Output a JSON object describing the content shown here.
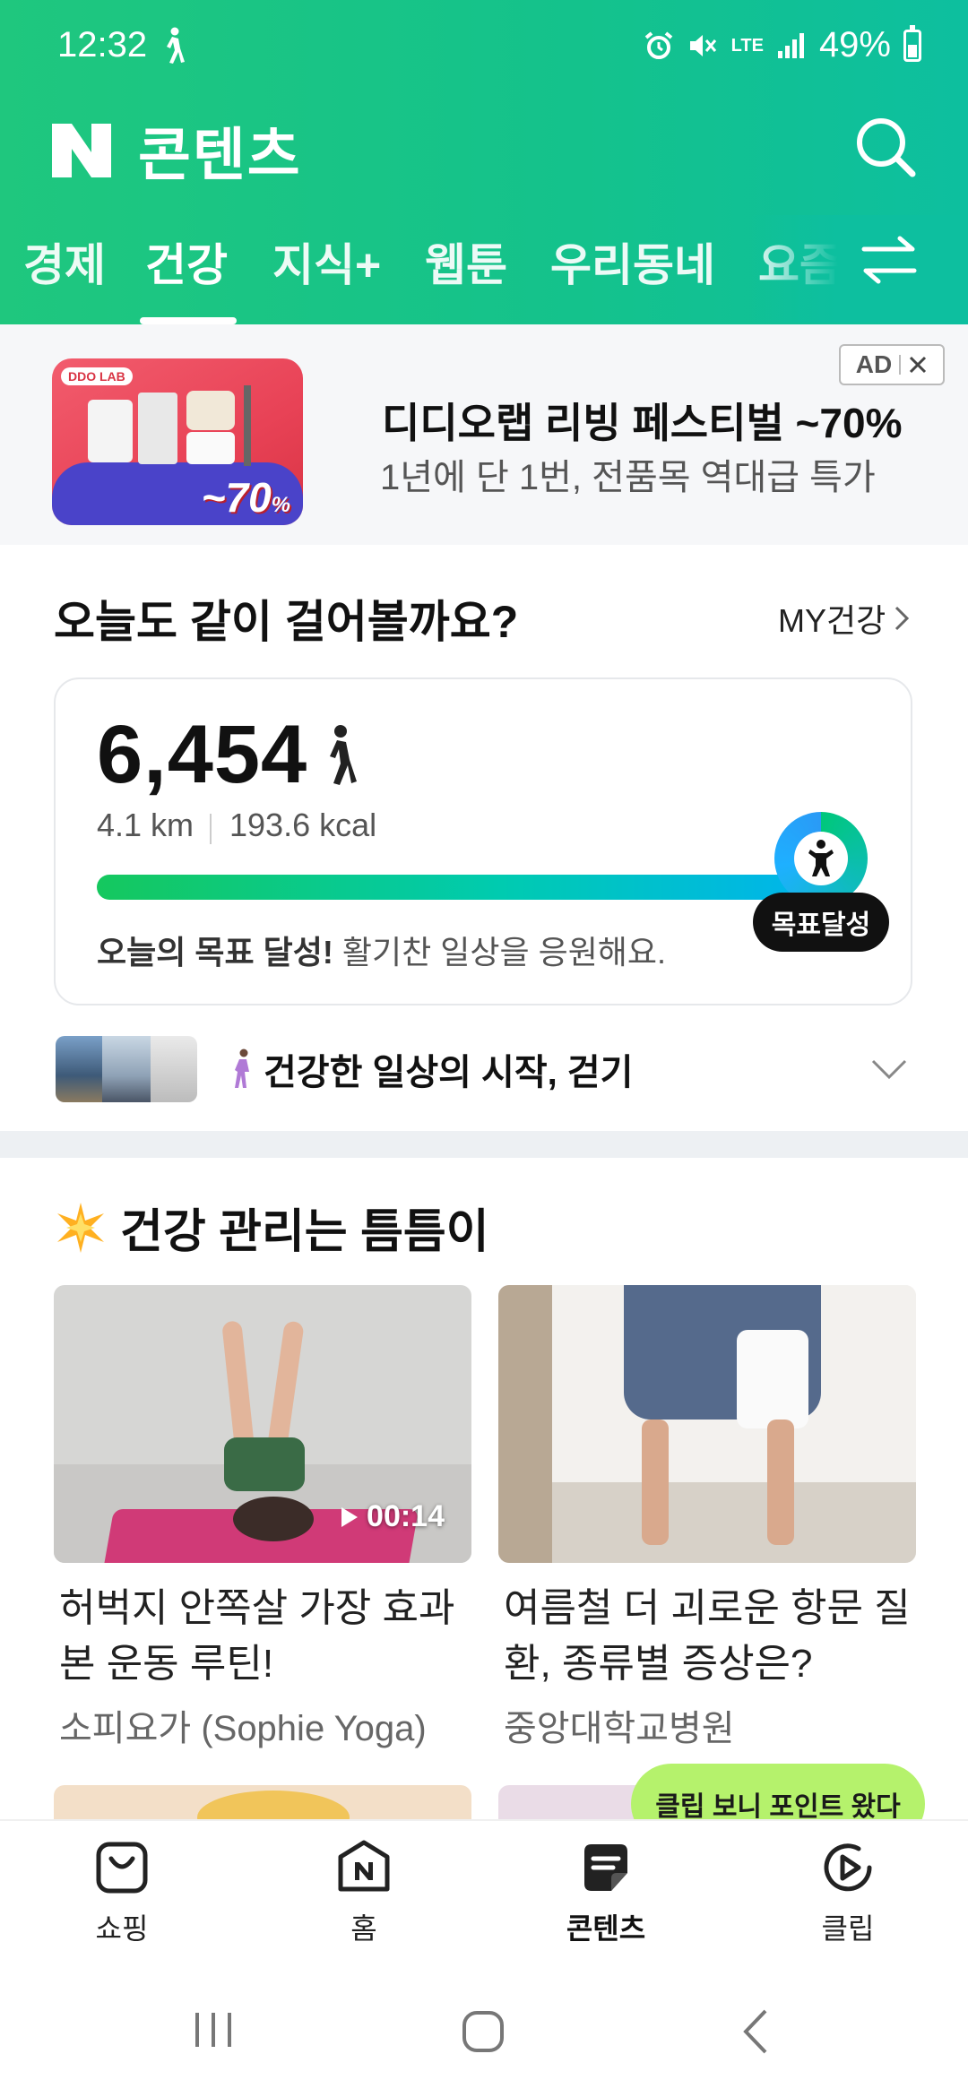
{
  "status": {
    "time": "12:32",
    "network": "LTE",
    "battery": "49%"
  },
  "header": {
    "title": "콘텐츠",
    "tabs": [
      "경제",
      "건강",
      "지식+",
      "웹툰",
      "우리동네",
      "요즘"
    ],
    "active_tab": "건강"
  },
  "ad": {
    "title": "디디오랩 리빙 페스티벌 ~70%",
    "subtitle": "1년에 단 1번, 전품목 역대급 특가",
    "badge": "AD",
    "image_brand": "DDO LAB",
    "image_discount": "~70",
    "image_discount_unit": "%"
  },
  "walk": {
    "heading": "오늘도 같이 걸어볼까요?",
    "my_health_link": "MY건강",
    "steps": "6,454",
    "distance": "4.1 km",
    "calories": "193.6 kcal",
    "progress": 1.0,
    "goal_badge": "목표달성",
    "goal_bold": "오늘의 목표 달성!",
    "goal_rest": " 활기찬 일상을 응원해요.",
    "topic": "건강한 일상의 시작, 걷기"
  },
  "health": {
    "heading": "건강 관리는 틈틈이",
    "cards": [
      {
        "title": "허벅지 안쪽살 가장 효과본 운동 루틴!",
        "source": "소피요가 (Sophie Yoga)",
        "duration": "00:14"
      },
      {
        "title": "여름철 더 괴로운 항문 질환, 종류별 증상은?",
        "source": "중앙대학교병원"
      }
    ]
  },
  "toast": "클립 보니 포인트 왔다",
  "bottom_nav": [
    {
      "label": "쇼핑",
      "icon": "shopping-bag-icon"
    },
    {
      "label": "홈",
      "icon": "naver-home-icon"
    },
    {
      "label": "콘텐츠",
      "icon": "contents-icon",
      "active": true
    },
    {
      "label": "클립",
      "icon": "clip-play-icon"
    }
  ],
  "colors": {
    "header_green": "#14c28c",
    "goal_pill": "#111111",
    "toast_bg": "#b5f26c"
  }
}
